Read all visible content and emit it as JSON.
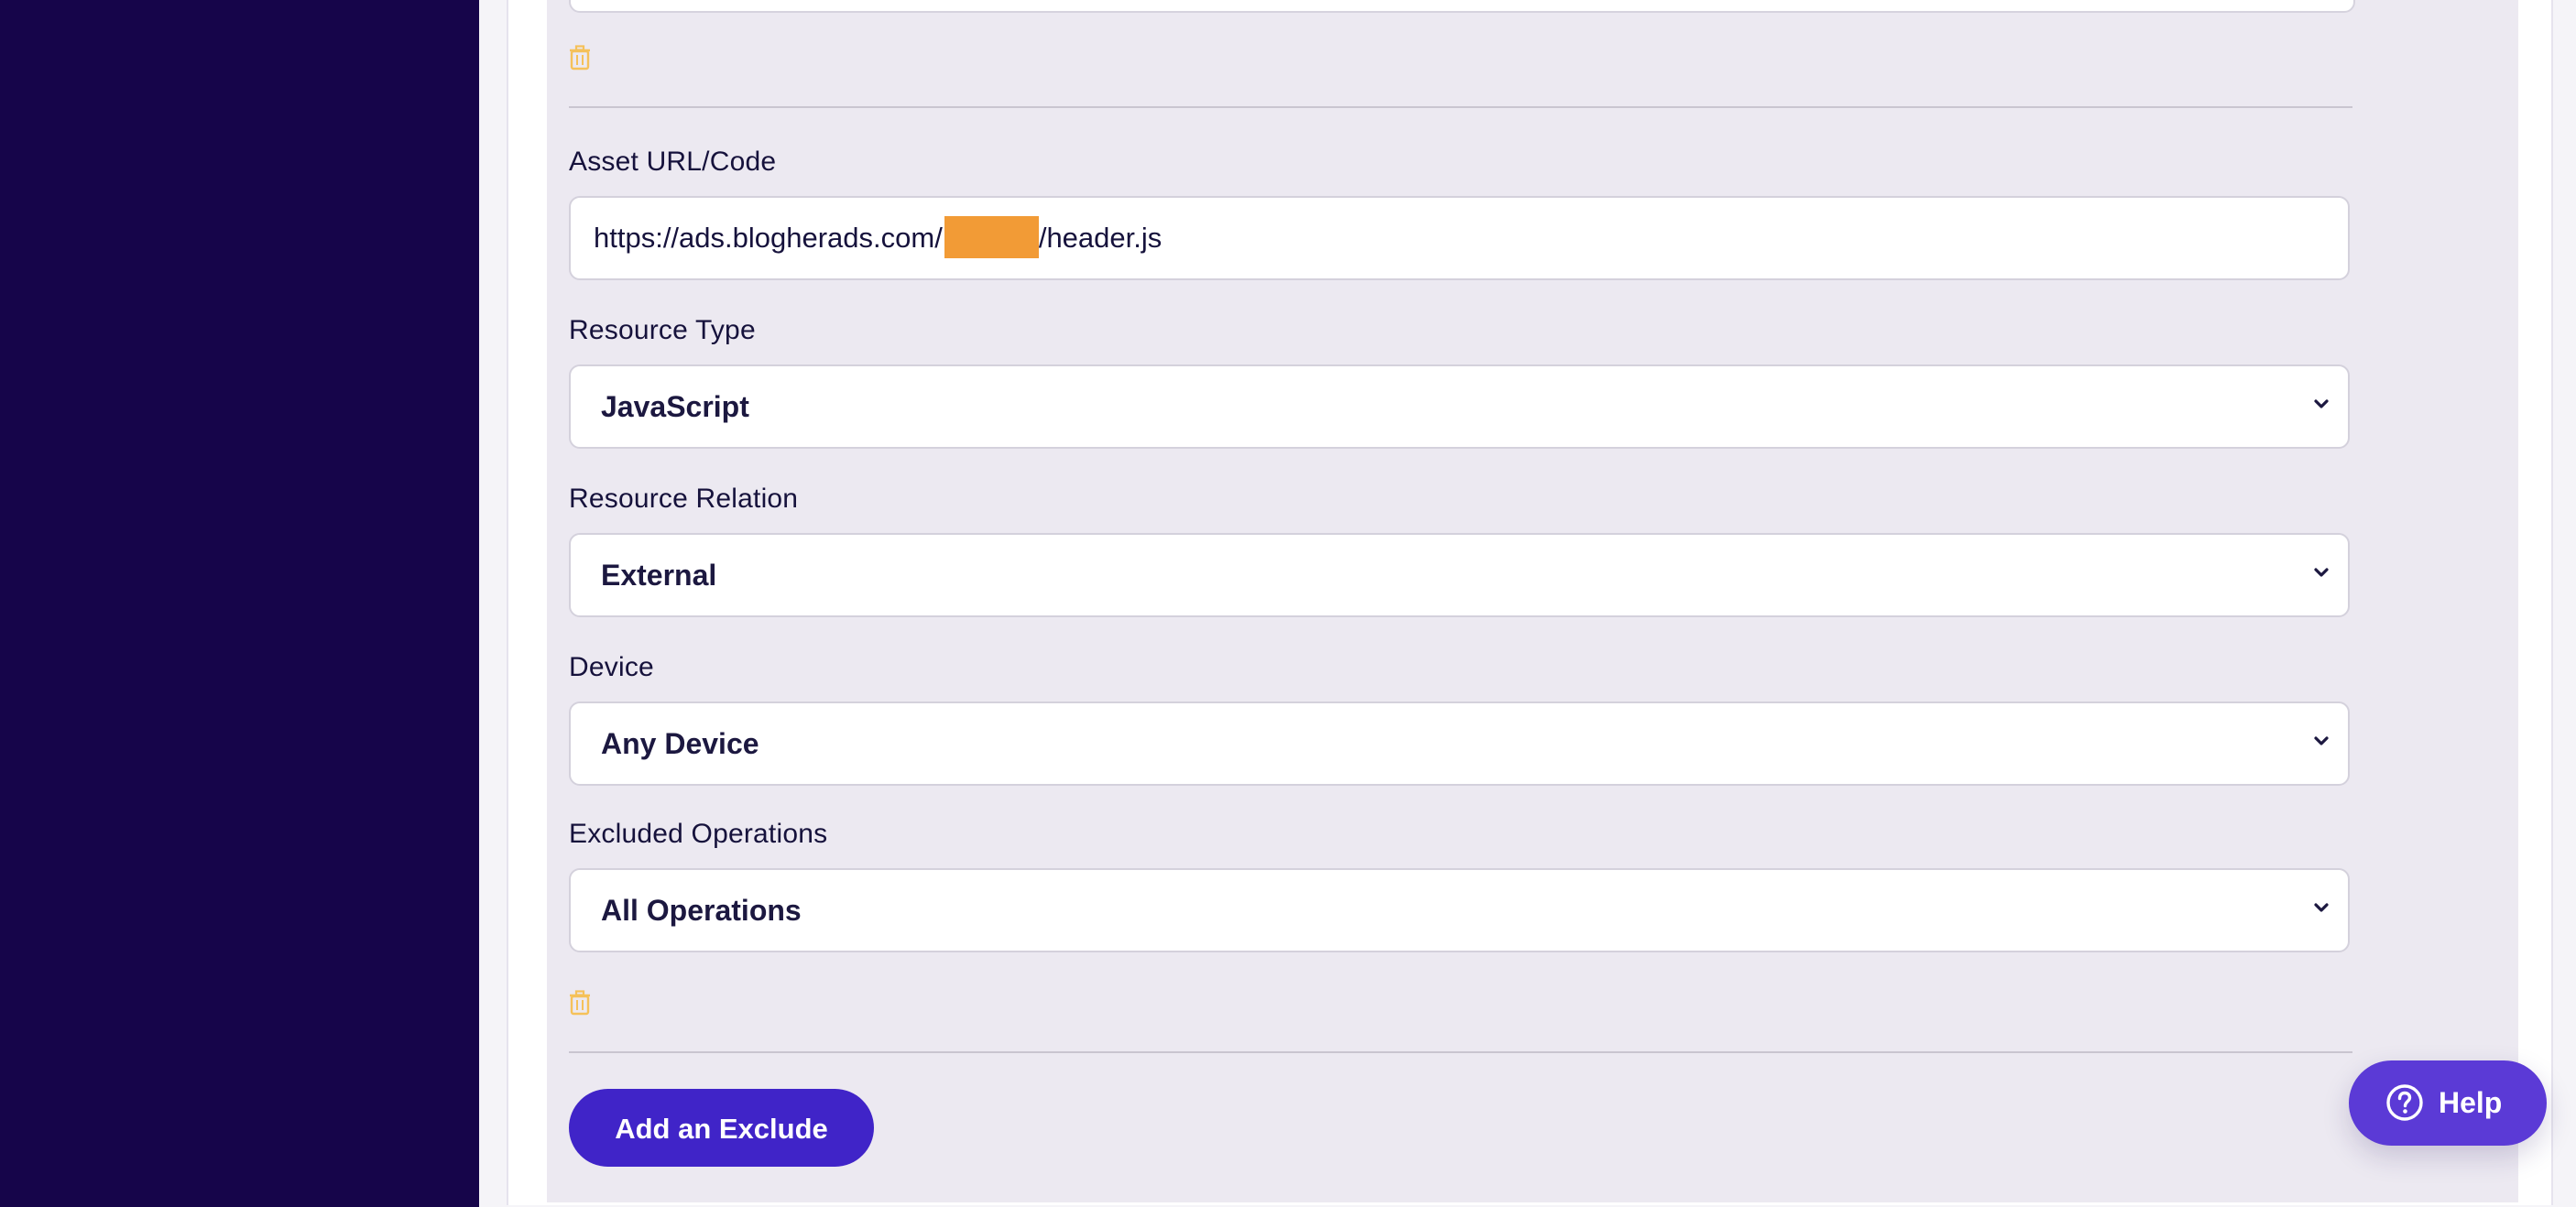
{
  "form": {
    "asset_url_label": "Asset URL/Code",
    "asset_url_value_prefix": "https://ads.blogherads.com/",
    "asset_url_value_suffix": "/header.js",
    "resource_type_label": "Resource Type",
    "resource_type_value": "JavaScript",
    "resource_relation_label": "Resource Relation",
    "resource_relation_value": "External",
    "device_label": "Device",
    "device_value": "Any Device",
    "excluded_operations_label": "Excluded Operations",
    "excluded_operations_value": "All Operations"
  },
  "actions": {
    "add_exclude_label": "Add an Exclude",
    "help_label": "Help"
  },
  "colors": {
    "sidebar": "#16054a",
    "primary_button": "#4024c8",
    "help_button": "#5b3ad6",
    "trash_icon": "#f5c15a",
    "redaction": "#f29b36"
  },
  "icons": {
    "delete": "trash-icon",
    "select": "chevron-down-icon",
    "help": "question-circle-icon"
  }
}
